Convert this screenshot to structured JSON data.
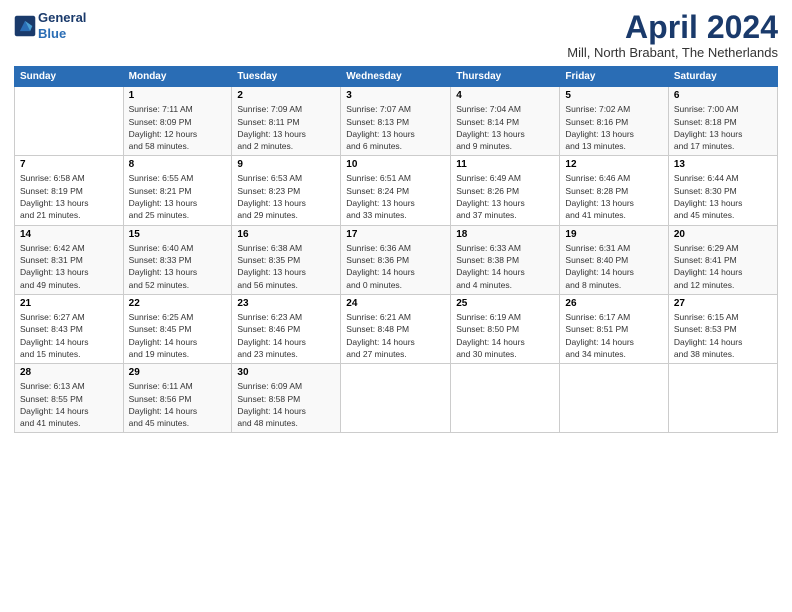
{
  "logo": {
    "line1": "General",
    "line2": "Blue"
  },
  "title": "April 2024",
  "location": "Mill, North Brabant, The Netherlands",
  "weekdays": [
    "Sunday",
    "Monday",
    "Tuesday",
    "Wednesday",
    "Thursday",
    "Friday",
    "Saturday"
  ],
  "weeks": [
    [
      {
        "num": "",
        "info": ""
      },
      {
        "num": "1",
        "info": "Sunrise: 7:11 AM\nSunset: 8:09 PM\nDaylight: 12 hours\nand 58 minutes."
      },
      {
        "num": "2",
        "info": "Sunrise: 7:09 AM\nSunset: 8:11 PM\nDaylight: 13 hours\nand 2 minutes."
      },
      {
        "num": "3",
        "info": "Sunrise: 7:07 AM\nSunset: 8:13 PM\nDaylight: 13 hours\nand 6 minutes."
      },
      {
        "num": "4",
        "info": "Sunrise: 7:04 AM\nSunset: 8:14 PM\nDaylight: 13 hours\nand 9 minutes."
      },
      {
        "num": "5",
        "info": "Sunrise: 7:02 AM\nSunset: 8:16 PM\nDaylight: 13 hours\nand 13 minutes."
      },
      {
        "num": "6",
        "info": "Sunrise: 7:00 AM\nSunset: 8:18 PM\nDaylight: 13 hours\nand 17 minutes."
      }
    ],
    [
      {
        "num": "7",
        "info": "Sunrise: 6:58 AM\nSunset: 8:19 PM\nDaylight: 13 hours\nand 21 minutes."
      },
      {
        "num": "8",
        "info": "Sunrise: 6:55 AM\nSunset: 8:21 PM\nDaylight: 13 hours\nand 25 minutes."
      },
      {
        "num": "9",
        "info": "Sunrise: 6:53 AM\nSunset: 8:23 PM\nDaylight: 13 hours\nand 29 minutes."
      },
      {
        "num": "10",
        "info": "Sunrise: 6:51 AM\nSunset: 8:24 PM\nDaylight: 13 hours\nand 33 minutes."
      },
      {
        "num": "11",
        "info": "Sunrise: 6:49 AM\nSunset: 8:26 PM\nDaylight: 13 hours\nand 37 minutes."
      },
      {
        "num": "12",
        "info": "Sunrise: 6:46 AM\nSunset: 8:28 PM\nDaylight: 13 hours\nand 41 minutes."
      },
      {
        "num": "13",
        "info": "Sunrise: 6:44 AM\nSunset: 8:30 PM\nDaylight: 13 hours\nand 45 minutes."
      }
    ],
    [
      {
        "num": "14",
        "info": "Sunrise: 6:42 AM\nSunset: 8:31 PM\nDaylight: 13 hours\nand 49 minutes."
      },
      {
        "num": "15",
        "info": "Sunrise: 6:40 AM\nSunset: 8:33 PM\nDaylight: 13 hours\nand 52 minutes."
      },
      {
        "num": "16",
        "info": "Sunrise: 6:38 AM\nSunset: 8:35 PM\nDaylight: 13 hours\nand 56 minutes."
      },
      {
        "num": "17",
        "info": "Sunrise: 6:36 AM\nSunset: 8:36 PM\nDaylight: 14 hours\nand 0 minutes."
      },
      {
        "num": "18",
        "info": "Sunrise: 6:33 AM\nSunset: 8:38 PM\nDaylight: 14 hours\nand 4 minutes."
      },
      {
        "num": "19",
        "info": "Sunrise: 6:31 AM\nSunset: 8:40 PM\nDaylight: 14 hours\nand 8 minutes."
      },
      {
        "num": "20",
        "info": "Sunrise: 6:29 AM\nSunset: 8:41 PM\nDaylight: 14 hours\nand 12 minutes."
      }
    ],
    [
      {
        "num": "21",
        "info": "Sunrise: 6:27 AM\nSunset: 8:43 PM\nDaylight: 14 hours\nand 15 minutes."
      },
      {
        "num": "22",
        "info": "Sunrise: 6:25 AM\nSunset: 8:45 PM\nDaylight: 14 hours\nand 19 minutes."
      },
      {
        "num": "23",
        "info": "Sunrise: 6:23 AM\nSunset: 8:46 PM\nDaylight: 14 hours\nand 23 minutes."
      },
      {
        "num": "24",
        "info": "Sunrise: 6:21 AM\nSunset: 8:48 PM\nDaylight: 14 hours\nand 27 minutes."
      },
      {
        "num": "25",
        "info": "Sunrise: 6:19 AM\nSunset: 8:50 PM\nDaylight: 14 hours\nand 30 minutes."
      },
      {
        "num": "26",
        "info": "Sunrise: 6:17 AM\nSunset: 8:51 PM\nDaylight: 14 hours\nand 34 minutes."
      },
      {
        "num": "27",
        "info": "Sunrise: 6:15 AM\nSunset: 8:53 PM\nDaylight: 14 hours\nand 38 minutes."
      }
    ],
    [
      {
        "num": "28",
        "info": "Sunrise: 6:13 AM\nSunset: 8:55 PM\nDaylight: 14 hours\nand 41 minutes."
      },
      {
        "num": "29",
        "info": "Sunrise: 6:11 AM\nSunset: 8:56 PM\nDaylight: 14 hours\nand 45 minutes."
      },
      {
        "num": "30",
        "info": "Sunrise: 6:09 AM\nSunset: 8:58 PM\nDaylight: 14 hours\nand 48 minutes."
      },
      {
        "num": "",
        "info": ""
      },
      {
        "num": "",
        "info": ""
      },
      {
        "num": "",
        "info": ""
      },
      {
        "num": "",
        "info": ""
      }
    ]
  ]
}
